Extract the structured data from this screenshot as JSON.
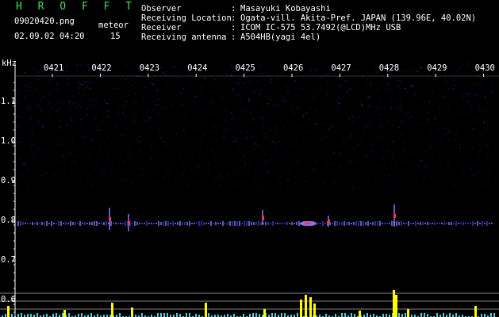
{
  "header": {
    "brand": "H R O F F T",
    "file_name": "09020420.png",
    "datetime": "02.09.02 04:20",
    "meteor_label": "meteor",
    "meteor_count": "15"
  },
  "info": [
    {
      "key": "Observer",
      "value": "Masayuki Kobayashi"
    },
    {
      "key": "Receiving Location",
      "value": "Ogata-vill. Akita-Pref. JAPAN (139.96E, 40.02N)"
    },
    {
      "key": "Receiver",
      "value": "ICOM IC-575 53.7492(@LCD)MHz USB"
    },
    {
      "key": "Receiving antenna",
      "value": "A504HB(yagi 4el)"
    }
  ],
  "plot": {
    "y_unit": "kHz",
    "x_ticks": [
      "0421",
      "0422",
      "0423",
      "0424",
      "0425",
      "0426",
      "0427",
      "0428",
      "0429",
      "0430"
    ],
    "y_ticks": [
      "1.1",
      "1.0",
      "0.9",
      "0.8",
      "0.7",
      "0.6"
    ],
    "colors": {
      "background": "#000000",
      "noise": "#1a1a6e",
      "signal": "#ffff00",
      "line": "#aaaaaa",
      "trace": "#4ad0e0",
      "meteor": "#ff3050"
    }
  }
}
